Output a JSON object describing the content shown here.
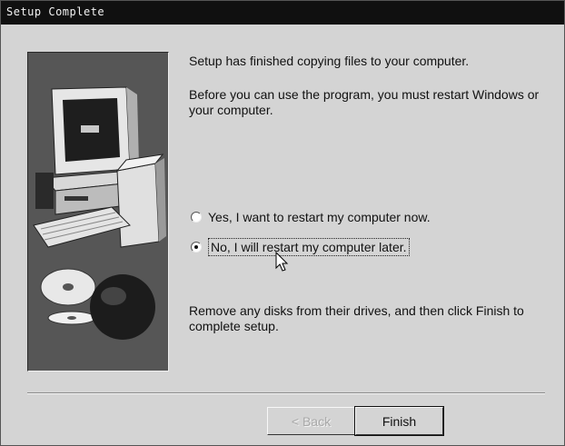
{
  "window": {
    "title": "Setup Complete"
  },
  "message": {
    "line1": "Setup has finished copying files to your computer.",
    "line2": "Before you can use the program, you must restart Windows or your computer.",
    "line3": "Remove any disks from their drives, and then click Finish to complete setup."
  },
  "options": {
    "restart_now": {
      "label": "Yes, I want to restart my computer now.",
      "selected": false
    },
    "restart_later": {
      "label": "No, I will restart my computer later.",
      "selected": true
    }
  },
  "buttons": {
    "back_label": "< Back",
    "back_enabled": false,
    "finish_label": "Finish"
  },
  "icons": [
    "computer-illustration",
    "cd-disc-icon",
    "mouse-cursor-icon"
  ]
}
